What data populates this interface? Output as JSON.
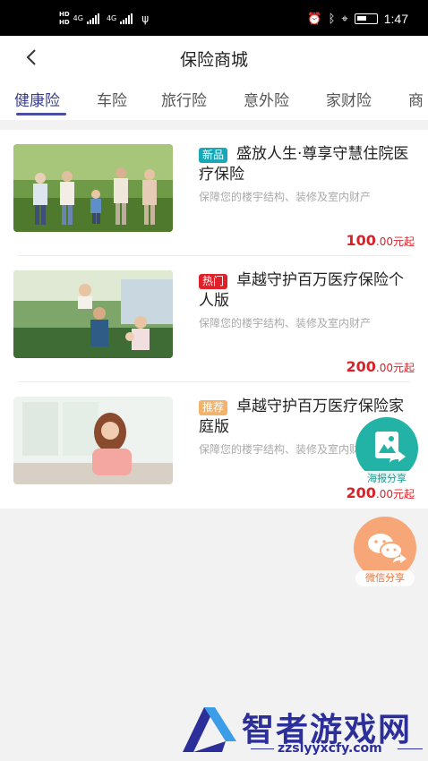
{
  "statusbar": {
    "hd_top": "HD",
    "hd_bottom": "HD",
    "net1": "4G",
    "net2": "4G",
    "time": "1:47"
  },
  "navbar": {
    "title": "保险商城"
  },
  "tabs": [
    {
      "label": "健康险"
    },
    {
      "label": "车险"
    },
    {
      "label": "旅行险"
    },
    {
      "label": "意外险"
    },
    {
      "label": "家财险"
    },
    {
      "label": "商"
    }
  ],
  "products": [
    {
      "badge": "新品",
      "badge_color": "#17a8b8",
      "title": "盛放人生·尊享守慧住院医疗保险",
      "desc": "保障您的楼宇结构、装修及室内财产",
      "price_int": "100",
      "price_suffix": ".00元起"
    },
    {
      "badge": "热门",
      "badge_color": "#e0212a",
      "title": "卓越守护百万医疗保险个人版",
      "desc": "保障您的楼宇结构、装修及室内财产",
      "price_int": "200",
      "price_suffix": ".00元起"
    },
    {
      "badge": "推荐",
      "badge_color": "#f2b36a",
      "title": "卓越守护百万医疗保险家庭版",
      "desc": "保障您的楼宇结构、装修及室内财产",
      "price_int": "200",
      "price_suffix": ".00元起"
    }
  ],
  "float": {
    "poster_label": "海报分享",
    "wechat_label": "微信分享"
  },
  "watermark": {
    "name": "智者游戏网",
    "url": "zzslyyxcfy.com"
  }
}
